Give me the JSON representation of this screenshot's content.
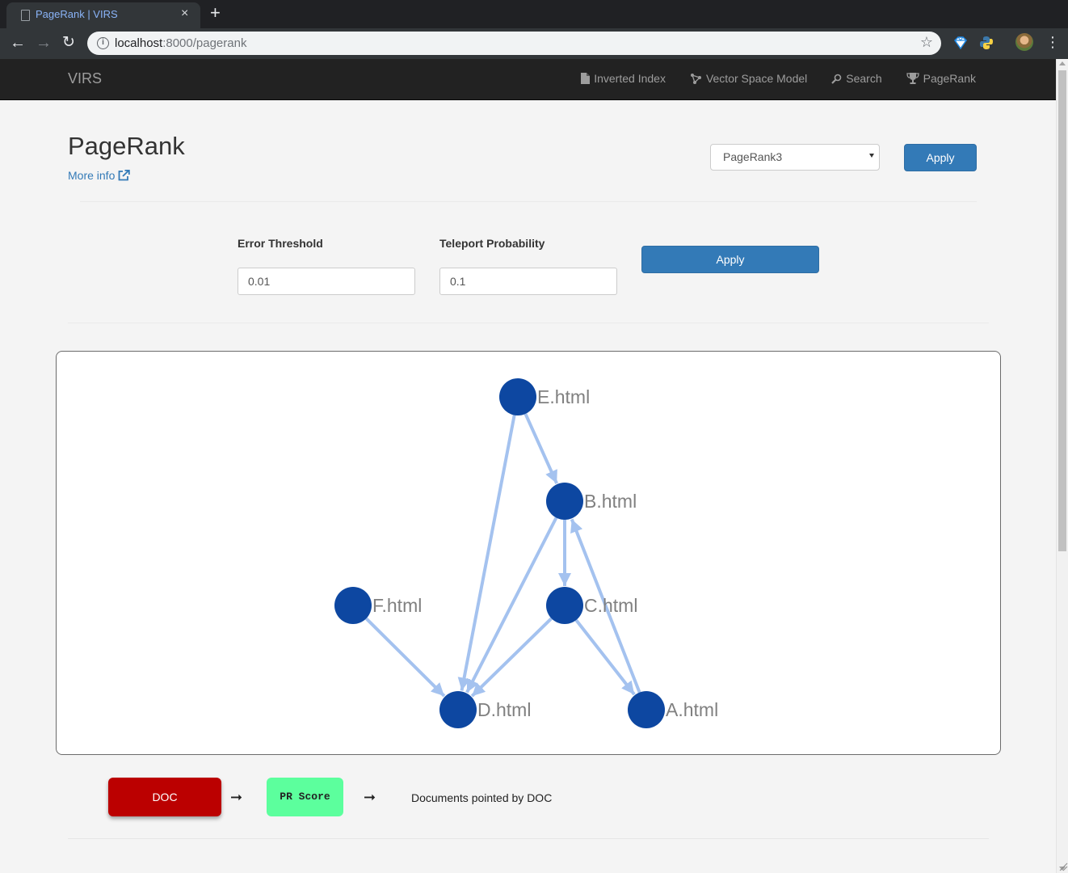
{
  "browser": {
    "tab_title": "PageRank | VIRS",
    "tab_close": "×",
    "new_tab": "+",
    "url_host": "localhost",
    "url_rest": ":8000/pagerank",
    "back": "←",
    "forward": "→",
    "reload": "↻",
    "star": "☆",
    "menu": "⋮",
    "info": "i"
  },
  "navbar": {
    "brand": "VIRS",
    "links": [
      {
        "label": "Inverted Index",
        "icon": "file-icon"
      },
      {
        "label": "Vector Space Model",
        "icon": "network-icon"
      },
      {
        "label": "Search",
        "icon": "zoom-icon"
      },
      {
        "label": "PageRank",
        "icon": "trophy-icon"
      }
    ]
  },
  "header": {
    "title": "PageRank",
    "more_info": "More info",
    "selected_algorithm": "PageRank3",
    "apply_label": "Apply"
  },
  "params": {
    "error_label": "Error Threshold",
    "error_value": "0.01",
    "teleport_label": "Teleport Probability",
    "teleport_value": "0.1",
    "apply_label": "Apply"
  },
  "graph": {
    "node_color": "#0d47a1",
    "edge_color": "#a4c2ef",
    "label_color": "#808080",
    "nodes": [
      {
        "id": "E",
        "label": "E.html"
      },
      {
        "id": "B",
        "label": "B.html"
      },
      {
        "id": "F",
        "label": "F.html"
      },
      {
        "id": "C",
        "label": "C.html"
      },
      {
        "id": "D",
        "label": "D.html"
      },
      {
        "id": "A",
        "label": "A.html"
      }
    ],
    "edges": [
      {
        "from": "E",
        "to": "B"
      },
      {
        "from": "E",
        "to": "D"
      },
      {
        "from": "B",
        "to": "C"
      },
      {
        "from": "B",
        "to": "D"
      },
      {
        "from": "C",
        "to": "D"
      },
      {
        "from": "C",
        "to": "A"
      },
      {
        "from": "A",
        "to": "B"
      },
      {
        "from": "F",
        "to": "D"
      }
    ]
  },
  "legend": {
    "doc_label": "DOC",
    "doc_color": "#bb0000",
    "score_label": "PR Score",
    "score_color": "#5cff9d",
    "arrow": "➞",
    "description": "Documents pointed by DOC"
  }
}
